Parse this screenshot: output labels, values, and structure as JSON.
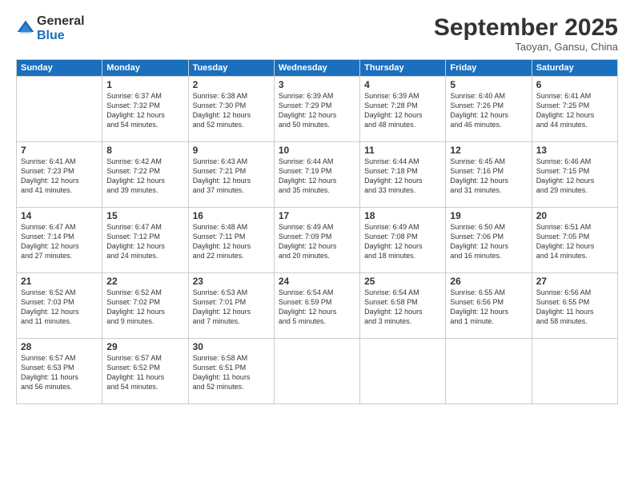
{
  "header": {
    "logo_general": "General",
    "logo_blue": "Blue",
    "month_title": "September 2025",
    "location": "Taoyan, Gansu, China"
  },
  "days_of_week": [
    "Sunday",
    "Monday",
    "Tuesday",
    "Wednesday",
    "Thursday",
    "Friday",
    "Saturday"
  ],
  "weeks": [
    [
      {
        "day": "",
        "info": ""
      },
      {
        "day": "1",
        "info": "Sunrise: 6:37 AM\nSunset: 7:32 PM\nDaylight: 12 hours\nand 54 minutes."
      },
      {
        "day": "2",
        "info": "Sunrise: 6:38 AM\nSunset: 7:30 PM\nDaylight: 12 hours\nand 52 minutes."
      },
      {
        "day": "3",
        "info": "Sunrise: 6:39 AM\nSunset: 7:29 PM\nDaylight: 12 hours\nand 50 minutes."
      },
      {
        "day": "4",
        "info": "Sunrise: 6:39 AM\nSunset: 7:28 PM\nDaylight: 12 hours\nand 48 minutes."
      },
      {
        "day": "5",
        "info": "Sunrise: 6:40 AM\nSunset: 7:26 PM\nDaylight: 12 hours\nand 46 minutes."
      },
      {
        "day": "6",
        "info": "Sunrise: 6:41 AM\nSunset: 7:25 PM\nDaylight: 12 hours\nand 44 minutes."
      }
    ],
    [
      {
        "day": "7",
        "info": "Sunrise: 6:41 AM\nSunset: 7:23 PM\nDaylight: 12 hours\nand 41 minutes."
      },
      {
        "day": "8",
        "info": "Sunrise: 6:42 AM\nSunset: 7:22 PM\nDaylight: 12 hours\nand 39 minutes."
      },
      {
        "day": "9",
        "info": "Sunrise: 6:43 AM\nSunset: 7:21 PM\nDaylight: 12 hours\nand 37 minutes."
      },
      {
        "day": "10",
        "info": "Sunrise: 6:44 AM\nSunset: 7:19 PM\nDaylight: 12 hours\nand 35 minutes."
      },
      {
        "day": "11",
        "info": "Sunrise: 6:44 AM\nSunset: 7:18 PM\nDaylight: 12 hours\nand 33 minutes."
      },
      {
        "day": "12",
        "info": "Sunrise: 6:45 AM\nSunset: 7:16 PM\nDaylight: 12 hours\nand 31 minutes."
      },
      {
        "day": "13",
        "info": "Sunrise: 6:46 AM\nSunset: 7:15 PM\nDaylight: 12 hours\nand 29 minutes."
      }
    ],
    [
      {
        "day": "14",
        "info": "Sunrise: 6:47 AM\nSunset: 7:14 PM\nDaylight: 12 hours\nand 27 minutes."
      },
      {
        "day": "15",
        "info": "Sunrise: 6:47 AM\nSunset: 7:12 PM\nDaylight: 12 hours\nand 24 minutes."
      },
      {
        "day": "16",
        "info": "Sunrise: 6:48 AM\nSunset: 7:11 PM\nDaylight: 12 hours\nand 22 minutes."
      },
      {
        "day": "17",
        "info": "Sunrise: 6:49 AM\nSunset: 7:09 PM\nDaylight: 12 hours\nand 20 minutes."
      },
      {
        "day": "18",
        "info": "Sunrise: 6:49 AM\nSunset: 7:08 PM\nDaylight: 12 hours\nand 18 minutes."
      },
      {
        "day": "19",
        "info": "Sunrise: 6:50 AM\nSunset: 7:06 PM\nDaylight: 12 hours\nand 16 minutes."
      },
      {
        "day": "20",
        "info": "Sunrise: 6:51 AM\nSunset: 7:05 PM\nDaylight: 12 hours\nand 14 minutes."
      }
    ],
    [
      {
        "day": "21",
        "info": "Sunrise: 6:52 AM\nSunset: 7:03 PM\nDaylight: 12 hours\nand 11 minutes."
      },
      {
        "day": "22",
        "info": "Sunrise: 6:52 AM\nSunset: 7:02 PM\nDaylight: 12 hours\nand 9 minutes."
      },
      {
        "day": "23",
        "info": "Sunrise: 6:53 AM\nSunset: 7:01 PM\nDaylight: 12 hours\nand 7 minutes."
      },
      {
        "day": "24",
        "info": "Sunrise: 6:54 AM\nSunset: 6:59 PM\nDaylight: 12 hours\nand 5 minutes."
      },
      {
        "day": "25",
        "info": "Sunrise: 6:54 AM\nSunset: 6:58 PM\nDaylight: 12 hours\nand 3 minutes."
      },
      {
        "day": "26",
        "info": "Sunrise: 6:55 AM\nSunset: 6:56 PM\nDaylight: 12 hours\nand 1 minute."
      },
      {
        "day": "27",
        "info": "Sunrise: 6:56 AM\nSunset: 6:55 PM\nDaylight: 11 hours\nand 58 minutes."
      }
    ],
    [
      {
        "day": "28",
        "info": "Sunrise: 6:57 AM\nSunset: 6:53 PM\nDaylight: 11 hours\nand 56 minutes."
      },
      {
        "day": "29",
        "info": "Sunrise: 6:57 AM\nSunset: 6:52 PM\nDaylight: 11 hours\nand 54 minutes."
      },
      {
        "day": "30",
        "info": "Sunrise: 6:58 AM\nSunset: 6:51 PM\nDaylight: 11 hours\nand 52 minutes."
      },
      {
        "day": "",
        "info": ""
      },
      {
        "day": "",
        "info": ""
      },
      {
        "day": "",
        "info": ""
      },
      {
        "day": "",
        "info": ""
      }
    ]
  ]
}
